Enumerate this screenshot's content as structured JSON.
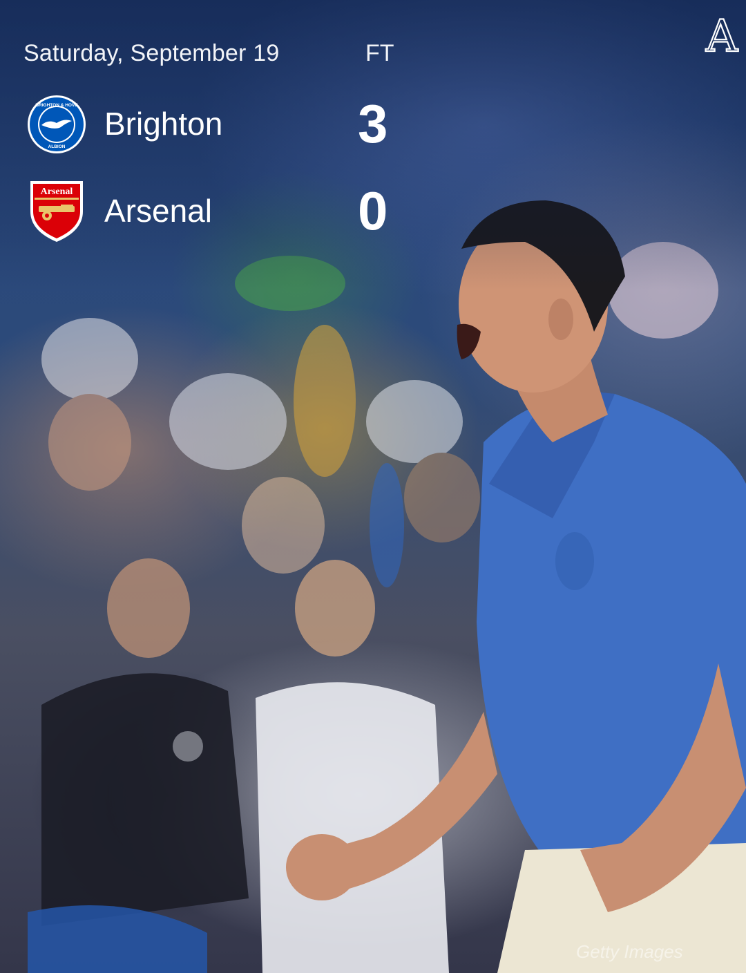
{
  "match": {
    "date": "Saturday, September 19",
    "status": "FT",
    "home_team": "Brighton",
    "home_score": "3",
    "away_team": "Arsenal",
    "away_score": "0"
  },
  "brand": {
    "logo_letter": "A"
  },
  "crests": {
    "brighton_ring_top": "BRIGHTON & HOVE",
    "brighton_ring_bottom": "ALBION",
    "arsenal_label": "Arsenal"
  },
  "photo": {
    "credit": "Getty Images"
  },
  "colors": {
    "brighton_blue": "#0057b8",
    "arsenal_red": "#db0007",
    "shirt_blue": "#3f6fc4",
    "text": "#ffffff"
  }
}
